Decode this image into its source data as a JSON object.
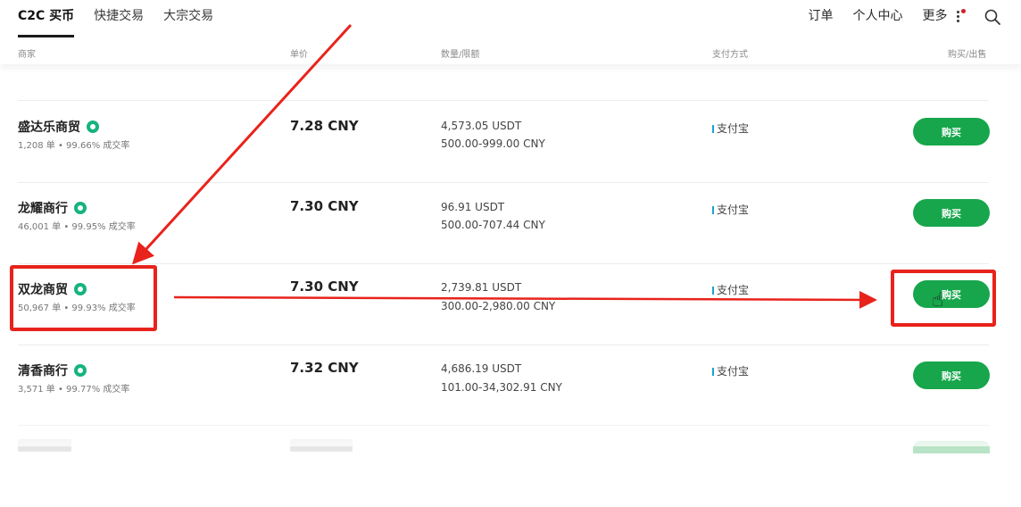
{
  "nav": {
    "tabs": [
      {
        "label": "C2C 买币",
        "active": true
      },
      {
        "label": "快捷交易",
        "active": false
      },
      {
        "label": "大宗交易",
        "active": false
      }
    ],
    "right": {
      "orders": "订单",
      "profile": "个人中心",
      "more": "更多"
    },
    "search_icon": "search-icon",
    "notification_dot_color": "#d0202a"
  },
  "columns": {
    "merchant": "商家",
    "price": "单价",
    "amount": "数量/限额",
    "payment": "支付方式",
    "action": "购买/出售"
  },
  "rows": [
    {
      "merchant": "盛达乐商贸",
      "stats": "1,208 单 • 99.66% 成交率",
      "price": "7.28 CNY",
      "quantity": "4,573.05 USDT",
      "limit": "500.00-999.00 CNY",
      "payment": "支付宝",
      "button": "购买"
    },
    {
      "merchant": "龙耀商行",
      "stats": "46,001 单 • 99.95% 成交率",
      "price": "7.30 CNY",
      "quantity": "96.91 USDT",
      "limit": "500.00-707.44 CNY",
      "payment": "支付宝",
      "button": "购买"
    },
    {
      "merchant": "双龙商贸",
      "stats": "50,967 单 • 99.93% 成交率",
      "price": "7.30 CNY",
      "quantity": "2,739.81 USDT",
      "limit": "300.00-2,980.00 CNY",
      "payment": "支付宝",
      "button": "购买"
    },
    {
      "merchant": "清香商行",
      "stats": "3,571 单 • 99.77% 成交率",
      "price": "7.32 CNY",
      "quantity": "4,686.19 USDT",
      "limit": "101.00-34,302.91 CNY",
      "payment": "支付宝",
      "button": "购买"
    }
  ],
  "colors": {
    "buy_button": "#17a64b",
    "verified_badge": "#15b37f",
    "alipay_bar": "#1aa3d8",
    "annotation": "#e8231c"
  }
}
